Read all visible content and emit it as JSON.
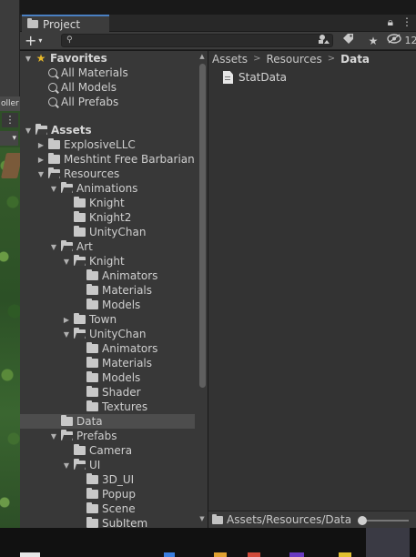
{
  "scene_strip": {
    "label": "oller",
    "menu_glyph": "⋮",
    "dropdown_glyph": "▾"
  },
  "project_tab": {
    "label": "Project"
  },
  "header_icons": {
    "lock": "🔒",
    "menu": "⋮"
  },
  "toolbar": {
    "add_glyph": "+",
    "add_caret": "▾",
    "search_placeholder": "",
    "hidden_count": "12"
  },
  "tree": {
    "favorites": {
      "label": "Favorites",
      "items": [
        "All Materials",
        "All Models",
        "All Prefabs"
      ]
    },
    "assets_label": "Assets",
    "rows": [
      {
        "label": "ExplosiveLLC",
        "depth": 1,
        "arrow": "▶"
      },
      {
        "label": "Meshtint Free Barbarian",
        "depth": 1,
        "arrow": "▶"
      },
      {
        "label": "Resources",
        "depth": 1,
        "arrow": "▼"
      },
      {
        "label": "Animations",
        "depth": 2,
        "arrow": "▼"
      },
      {
        "label": "Knight",
        "depth": 3,
        "arrow": ""
      },
      {
        "label": "Knight2",
        "depth": 3,
        "arrow": ""
      },
      {
        "label": "UnityChan",
        "depth": 3,
        "arrow": ""
      },
      {
        "label": "Art",
        "depth": 2,
        "arrow": "▼"
      },
      {
        "label": "Knight",
        "depth": 3,
        "arrow": "▼"
      },
      {
        "label": "Animators",
        "depth": 4,
        "arrow": ""
      },
      {
        "label": "Materials",
        "depth": 4,
        "arrow": ""
      },
      {
        "label": "Models",
        "depth": 4,
        "arrow": ""
      },
      {
        "label": "Town",
        "depth": 3,
        "arrow": "▶"
      },
      {
        "label": "UnityChan",
        "depth": 3,
        "arrow": "▼"
      },
      {
        "label": "Animators",
        "depth": 4,
        "arrow": ""
      },
      {
        "label": "Materials",
        "depth": 4,
        "arrow": ""
      },
      {
        "label": "Models",
        "depth": 4,
        "arrow": ""
      },
      {
        "label": "Shader",
        "depth": 4,
        "arrow": ""
      },
      {
        "label": "Textures",
        "depth": 4,
        "arrow": ""
      },
      {
        "label": "Data",
        "depth": 2,
        "arrow": "",
        "selected": true
      },
      {
        "label": "Prefabs",
        "depth": 2,
        "arrow": "▼"
      },
      {
        "label": "Camera",
        "depth": 3,
        "arrow": ""
      },
      {
        "label": "UI",
        "depth": 3,
        "arrow": "▼"
      },
      {
        "label": "3D_UI",
        "depth": 4,
        "arrow": ""
      },
      {
        "label": "Popup",
        "depth": 4,
        "arrow": ""
      },
      {
        "label": "Scene",
        "depth": 4,
        "arrow": ""
      },
      {
        "label": "SubItem",
        "depth": 4,
        "arrow": ""
      }
    ]
  },
  "breadcrumb": {
    "items": [
      "Assets",
      "Resources"
    ],
    "current": "Data",
    "separator": ">"
  },
  "content": {
    "items": [
      {
        "label": "StatData",
        "icon": "scriptable-object-icon"
      }
    ]
  },
  "status_bar": {
    "path": "Assets/Resources/Data",
    "zoom_fraction": 0.0
  },
  "colors": {
    "selection": "#4d4d4d",
    "favorite_star": "#e8b92a",
    "tab_accent": "#4a80c2"
  }
}
